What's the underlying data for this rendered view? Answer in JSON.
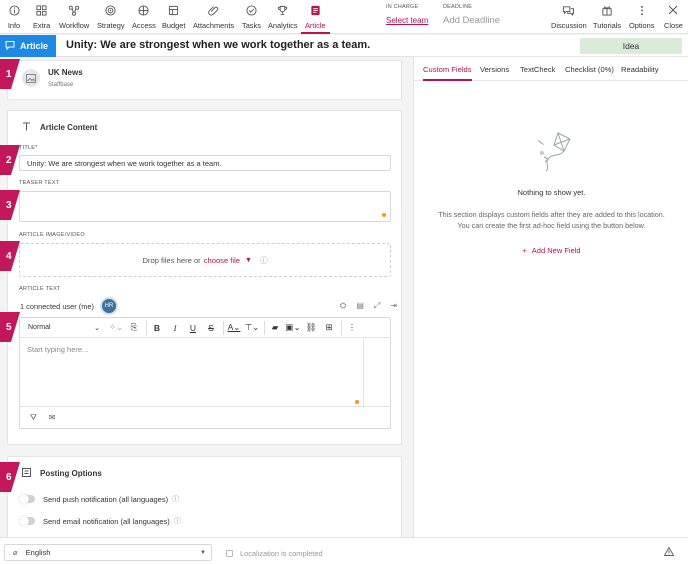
{
  "toolbar": {
    "items": [
      {
        "label": "Info",
        "icon": "info-icon"
      },
      {
        "label": "Extra",
        "icon": "grid-icon"
      },
      {
        "label": "Workflow",
        "icon": "workflow-icon"
      },
      {
        "label": "Strategy",
        "icon": "strategy-icon"
      },
      {
        "label": "Access",
        "icon": "access-icon"
      },
      {
        "label": "Budget",
        "icon": "budget-icon"
      },
      {
        "label": "Attachments",
        "icon": "paperclip-icon"
      },
      {
        "label": "Tasks",
        "icon": "tasks-icon"
      },
      {
        "label": "Analytics",
        "icon": "trophy-icon"
      },
      {
        "label": "Article",
        "icon": "article-icon",
        "active": true
      },
      {
        "label": "Discussion",
        "icon": "discussion-icon"
      },
      {
        "label": "Tutorials",
        "icon": "tutorials-icon"
      },
      {
        "label": "Options",
        "icon": "more-vertical-icon"
      },
      {
        "label": "Close",
        "icon": "close-icon"
      }
    ],
    "in_charge_label": "IN CHARGE",
    "in_charge_value": "Select team",
    "deadline_label": "DEADLINE",
    "deadline_value": "Add Deadline"
  },
  "titlebar": {
    "badge": "Article",
    "title": "Unity: We are strongest when we work together as a team.",
    "status": "Idea"
  },
  "channel": {
    "marker": "1",
    "name": "UK News",
    "sub": "Staffbase"
  },
  "article_content": {
    "heading": "Article Content",
    "title_label": "TITLE",
    "title_required": "*",
    "title_value": "Unity: We are strongest when we work together as a team.",
    "teaser_label": "TEASER TEXT",
    "teaser_value": "",
    "image_label": "ARTICLE IMAGE/VIDEO",
    "drop_text": "Drop files here or",
    "drop_link": "choose file",
    "text_label": "ARTICLE TEXT",
    "connected": "1 connected user (me)",
    "avatar_initials": "HR",
    "style_value": "Normal",
    "editor_placeholder": "Start typing here...",
    "markers": [
      "2",
      "3",
      "4",
      "5"
    ]
  },
  "posting": {
    "marker": "6",
    "heading": "Posting Options",
    "push_label": "Send push notification (all languages)",
    "email_label": "Send email notification (all languages)"
  },
  "right_panel": {
    "tabs": [
      "Custom Fields",
      "Versions",
      "TextCheck",
      "Checklist (0%)",
      "Readability"
    ],
    "empty_title": "Nothing to show yet.",
    "empty_desc_1": "This section displays custom fields after they are added to this location.",
    "empty_desc_2": "You can create the first ad-hoc field using the button below.",
    "add_field": "Add New Field"
  },
  "bottombar": {
    "language": "English",
    "localization": "Localization is completed"
  },
  "colors": {
    "accent": "#b6134f",
    "marker": "#c2185b",
    "badge": "#1e88e5",
    "idea": "#d8ecd8"
  }
}
